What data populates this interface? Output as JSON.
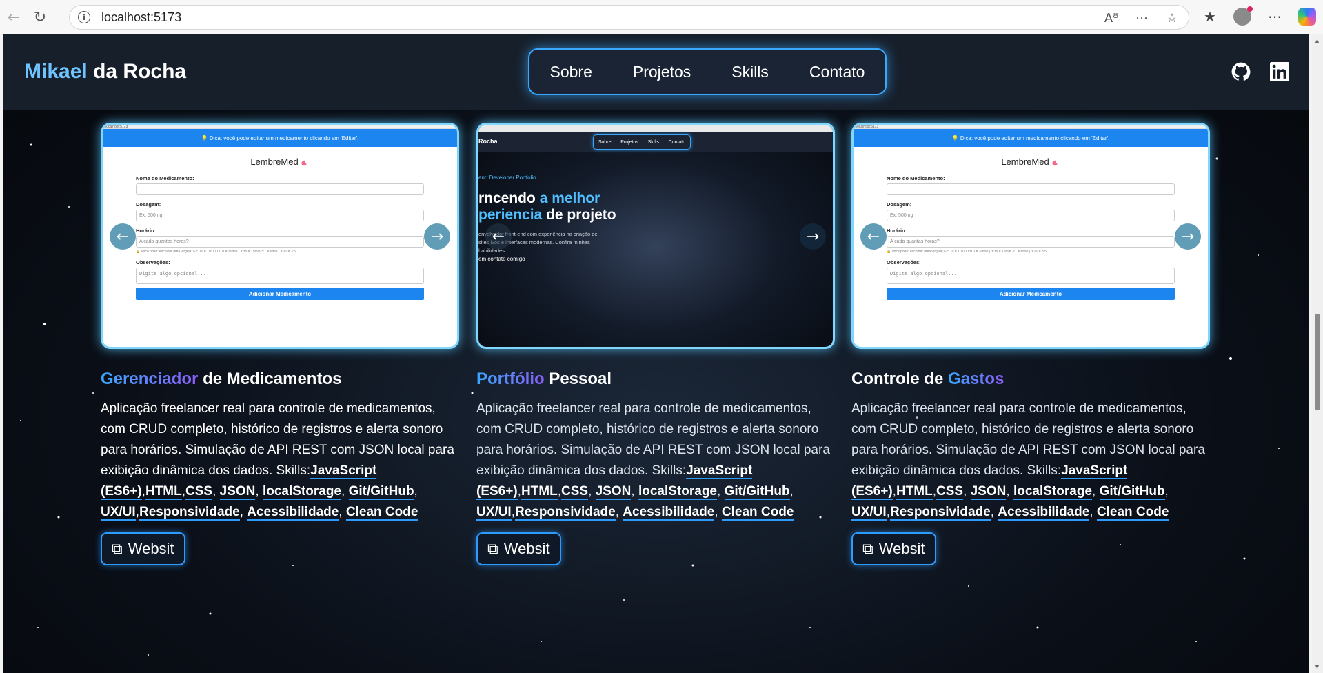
{
  "browser": {
    "url": "localhost:5173"
  },
  "header": {
    "logo_first": "Mikael",
    "logo_rest": "da Rocha",
    "nav": [
      "Sobre",
      "Projetos",
      "Skills",
      "Contato"
    ]
  },
  "mock_lembremed": {
    "tab_text": "localhost:5173",
    "banner": "💡 Dica: você pode editar um medicamento clicando em 'Editar'.",
    "title": "LembreMed",
    "label_name": "Nome do Medicamento:",
    "label_dose": "Dosagem:",
    "dose_placeholder": "Ex: 500mg",
    "label_time": "Horário:",
    "time_placeholder": "A cada quantas horas?",
    "note": "🔒 Você pode: escolher uma vírgula; Ex: 10 = 10:00  1:0.0 = 30min | 3:35 = 15min  3:1 = 6min | 3:21 = 3:5",
    "label_obs": "Observações:",
    "obs_placeholder": "Digite algo opcional...",
    "button": "Adicionar Medicamento"
  },
  "mock_portfolio": {
    "logo": "Rocha",
    "nav": [
      "Sobre",
      "Projetos",
      "Skills",
      "Contato"
    ],
    "subtitle": "end Developer Portfolio",
    "h1_a": "rncendo",
    "h1_hl1": "a melhor",
    "h1_hl2": "periencia",
    "h1_b": "de projeto",
    "p": "envolvedor front-end com experiência na criação de sites ivos e interfaces modernas. Confira minhas habilidades.",
    "cta": "em contato comigo"
  },
  "cards": [
    {
      "title_hl": "Gerenciador",
      "title_rest": "de Medicamentos",
      "desc": "Aplicação freelancer real para controle de medicamentos, com CRUD completo, histórico de registros e alerta sonoro para horários. Simulação de API REST com JSON local para exibição dinâmica dos dados. Skills:",
      "button": "Websit"
    },
    {
      "title_hl": "Portfólio",
      "title_rest": "Pessoal",
      "desc": "Aplicação freelancer real para controle de medicamentos, com CRUD completo, histórico de registros e alerta sonoro para horários. Simulação de API REST com JSON local para exibição dinâmica dos dados. Skills:",
      "button": "Websit"
    },
    {
      "title_pre": "Controle de",
      "title_hl": "Gastos",
      "desc": "Aplicação freelancer real para controle de medicamentos, com CRUD completo, histórico de registros e alerta sonoro para horários. Simulação de API REST com JSON local para exibição dinâmica dos dados. Skills:",
      "button": "Websit"
    }
  ],
  "skills": {
    "s1": "JavaScript (ES6+)",
    "s2": "HTML",
    "s3": "CSS",
    "s4": "JSON",
    "s5": "localStorage",
    "s6": "Git/GitHub",
    "s7": "UX/UI",
    "s8": "Responsividade",
    "s9": "Acessibilidade",
    "s10": "Clean Code"
  },
  "colors": {
    "accent": "#2e9bff",
    "background": "#0b1019"
  }
}
